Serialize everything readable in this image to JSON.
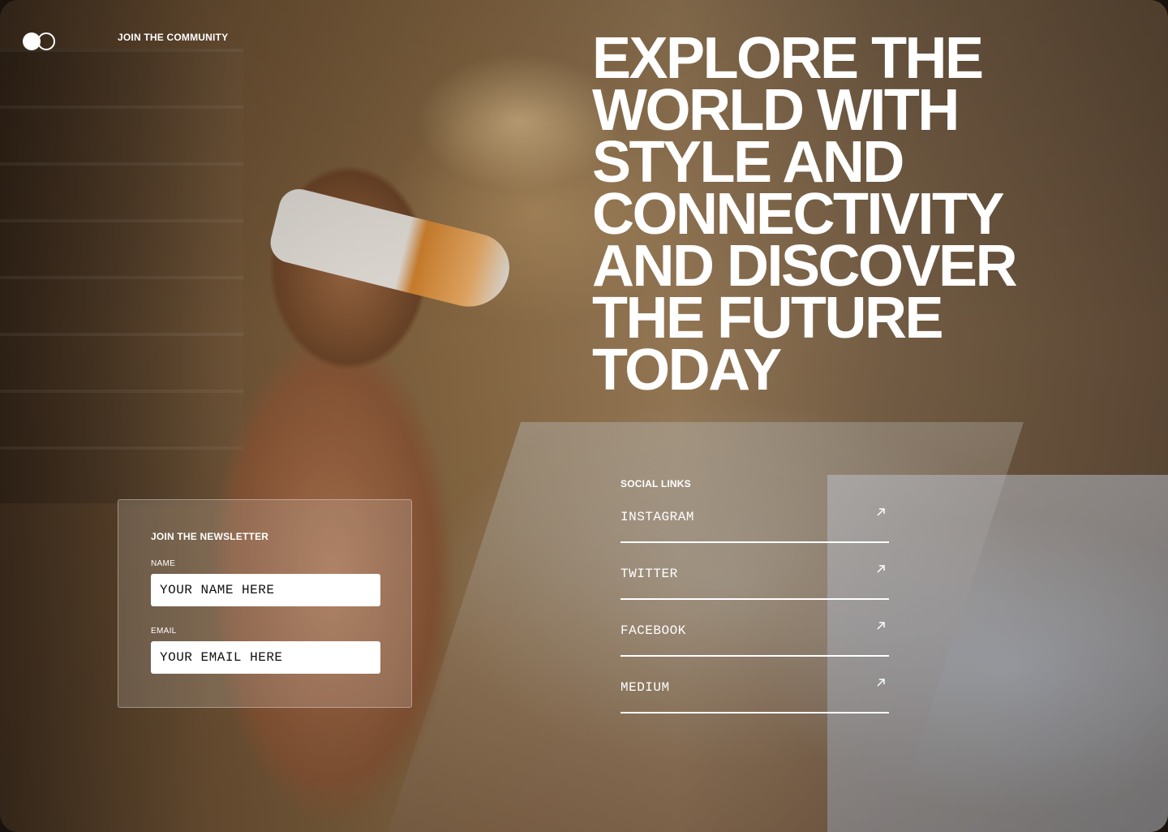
{
  "header": {
    "join_link": "JOIN THE COMMUNITY"
  },
  "hero": {
    "headline_lines": [
      "EXPLORE THE",
      "WORLD WITH",
      "STYLE AND",
      "CONNECTIVITY",
      "AND DISCOVER",
      "THE FUTURE",
      "TODAY"
    ]
  },
  "newsletter": {
    "title": "JOIN THE NEWSLETTER",
    "name_label": "NAME",
    "name_placeholder": "YOUR NAME HERE",
    "email_label": "EMAIL",
    "email_placeholder": "YOUR EMAIL HERE"
  },
  "social": {
    "heading": "SOCIAL LINKS",
    "links": [
      {
        "label": "INSTAGRAM",
        "icon": "arrow-up-right-icon"
      },
      {
        "label": "TWITTER",
        "icon": "arrow-up-right-icon"
      },
      {
        "label": "FACEBOOK",
        "icon": "arrow-up-right-icon"
      },
      {
        "label": "MEDIUM",
        "icon": "arrow-up-right-icon"
      }
    ]
  },
  "colors": {
    "text": "#ffffff",
    "input_bg": "#ffffff",
    "input_text": "#111111"
  }
}
